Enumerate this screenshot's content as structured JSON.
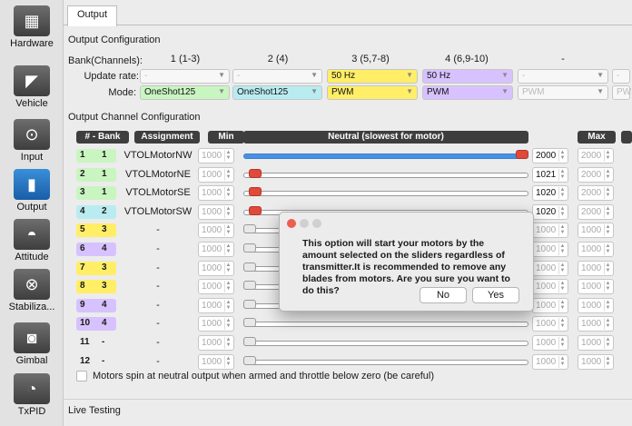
{
  "tab": "Output",
  "sidebar": {
    "items": [
      {
        "label": "Hardware",
        "icon": "chip-icon"
      },
      {
        "label": "Vehicle",
        "icon": "vehicle-icon"
      },
      {
        "label": "Input",
        "icon": "transmitter-icon"
      },
      {
        "label": "Output",
        "icon": "motor-icon"
      },
      {
        "label": "Attitude",
        "icon": "horizon-icon"
      },
      {
        "label": "Stabiliza...",
        "icon": "gyro-icon"
      },
      {
        "label": "Gimbal",
        "icon": "camera-icon"
      },
      {
        "label": "TxPID",
        "icon": "gauge-icon"
      }
    ]
  },
  "output_config": {
    "title": "Output Configuration",
    "bank_label": "Bank(Channels):",
    "update_rate_label": "Update rate:",
    "mode_label": "Mode:",
    "banks": [
      {
        "header": "1 (1-3)",
        "rate": "-",
        "mode": "OneShot125",
        "rate_enabled": false,
        "mode_color": "green"
      },
      {
        "header": "2 (4)",
        "rate": "-",
        "mode": "OneShot125",
        "rate_enabled": false,
        "mode_color": "cyan"
      },
      {
        "header": "3 (5,7-8)",
        "rate": "50 Hz",
        "mode": "PWM",
        "rate_enabled": true,
        "mode_color": "yellow"
      },
      {
        "header": "4 (6,9-10)",
        "rate": "50 Hz",
        "mode": "PWM",
        "rate_enabled": true,
        "mode_color": "purple"
      },
      {
        "header": "-",
        "rate": "-",
        "mode": "PWM",
        "rate_enabled": false,
        "mode_color": "none"
      },
      {
        "header": "",
        "rate": "-",
        "mode": "PW",
        "rate_enabled": false,
        "mode_color": "none"
      }
    ]
  },
  "channel_config": {
    "title": "Output Channel Configuration",
    "headers": {
      "bank": "# - Bank",
      "assignment": "Assignment",
      "min": "Min",
      "neutral": "Neutral (slowest for motor)",
      "max": "Max"
    },
    "rows": [
      {
        "ch": "1",
        "bank": "1",
        "assignment": "VTOLMotorNW",
        "min": "1000",
        "neutral": "2000",
        "max": "2000",
        "neutral_frac": 1.0,
        "active": true,
        "color": "#c9f5c0"
      },
      {
        "ch": "2",
        "bank": "1",
        "assignment": "VTOLMotorNE",
        "min": "1000",
        "neutral": "1021",
        "max": "2000",
        "neutral_frac": 0.021,
        "active": true,
        "color": "#c9f5c0"
      },
      {
        "ch": "3",
        "bank": "1",
        "assignment": "VTOLMotorSE",
        "min": "1000",
        "neutral": "1020",
        "max": "2000",
        "neutral_frac": 0.02,
        "active": true,
        "color": "#c9f5c0"
      },
      {
        "ch": "4",
        "bank": "2",
        "assignment": "VTOLMotorSW",
        "min": "1000",
        "neutral": "1020",
        "max": "2000",
        "neutral_frac": 0.02,
        "active": true,
        "color": "#b9ecf0"
      },
      {
        "ch": "5",
        "bank": "3",
        "assignment": "-",
        "min": "1000",
        "neutral": "1000",
        "max": "1000",
        "neutral_frac": 0.0,
        "active": false,
        "color": "#ffee66"
      },
      {
        "ch": "6",
        "bank": "4",
        "assignment": "-",
        "min": "1000",
        "neutral": "1000",
        "max": "1000",
        "neutral_frac": 0.0,
        "active": false,
        "color": "#d7c2ff"
      },
      {
        "ch": "7",
        "bank": "3",
        "assignment": "-",
        "min": "1000",
        "neutral": "1000",
        "max": "1000",
        "neutral_frac": 0.0,
        "active": false,
        "color": "#ffee66"
      },
      {
        "ch": "8",
        "bank": "3",
        "assignment": "-",
        "min": "1000",
        "neutral": "1000",
        "max": "1000",
        "neutral_frac": 0.0,
        "active": false,
        "color": "#ffee66"
      },
      {
        "ch": "9",
        "bank": "4",
        "assignment": "-",
        "min": "1000",
        "neutral": "1000",
        "max": "1000",
        "neutral_frac": 0.0,
        "active": false,
        "color": "#d7c2ff"
      },
      {
        "ch": "10",
        "bank": "4",
        "assignment": "-",
        "min": "1000",
        "neutral": "1000",
        "max": "1000",
        "neutral_frac": 0.0,
        "active": false,
        "color": "#d7c2ff"
      },
      {
        "ch": "11",
        "bank": "-",
        "assignment": "-",
        "min": "1000",
        "neutral": "1000",
        "max": "1000",
        "neutral_frac": 0.0,
        "active": false,
        "color": "none"
      },
      {
        "ch": "12",
        "bank": "-",
        "assignment": "-",
        "min": "1000",
        "neutral": "1000",
        "max": "1000",
        "neutral_frac": 0.0,
        "active": false,
        "color": "none"
      }
    ],
    "motors_spin_label": "Motors spin at neutral output when armed and throttle below zero (be careful)"
  },
  "live_testing": {
    "title": "Live Testing"
  },
  "dialog": {
    "message": "This option will start your motors by the amount selected on the sliders regardless of transmitter.It is recommended to remove any blades from motors. Are you sure you want to do this?",
    "no_label": "No",
    "yes_label": "Yes"
  },
  "colors": {
    "accent": "#3b7fd0",
    "knob": "#e04a3a",
    "bank1": "#c9f5c0",
    "bank2": "#b9ecf0",
    "bank3": "#ffee66",
    "bank4": "#d7c2ff"
  }
}
